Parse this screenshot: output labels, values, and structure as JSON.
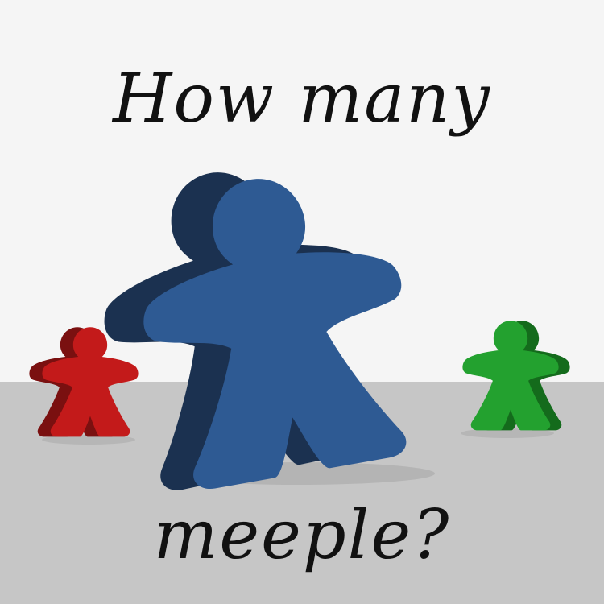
{
  "caption": {
    "top_text": "How many",
    "bottom_text": "meeple?"
  },
  "colors": {
    "wall": "#f5f5f5",
    "floor": "#c6c6c6",
    "text": "#111111",
    "blue_meeple": "#2e5a93",
    "red_meeple": "#c31a1a",
    "green_meeple": "#23a12f"
  },
  "meeples": [
    {
      "color_name": "red"
    },
    {
      "color_name": "blue"
    },
    {
      "color_name": "green"
    }
  ]
}
